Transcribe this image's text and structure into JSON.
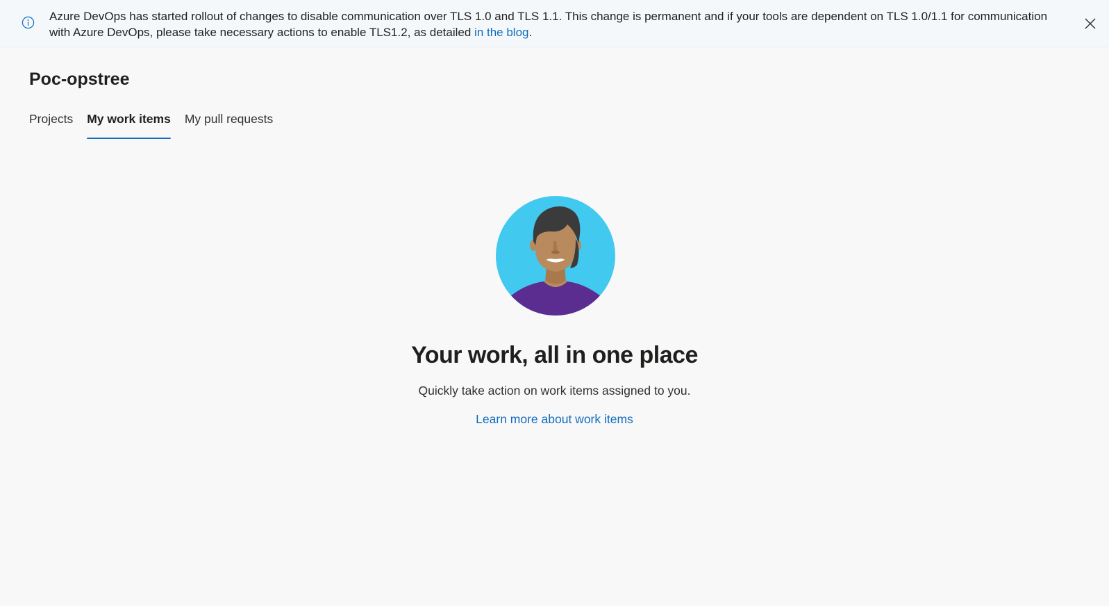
{
  "banner": {
    "icon": "info-icon",
    "message": "Azure DevOps has started rollout of changes to disable communication over TLS 1.0 and TLS 1.1. This change is permanent and if your tools are dependent on TLS 1.0/1.1 for communication with Azure DevOps, please take necessary actions to enable TLS1.2, as detailed ",
    "link_text": "in the blog",
    "trailing": ".",
    "close_icon": "close-icon"
  },
  "org": {
    "title": "Poc-opstree"
  },
  "tabs": [
    {
      "label": "Projects",
      "active": false
    },
    {
      "label": "My work items",
      "active": true
    },
    {
      "label": "My pull requests",
      "active": false
    }
  ],
  "empty_state": {
    "illustration": "person-avatar-illustration",
    "headline": "Your work, all in one place",
    "description": "Quickly take action on work items assigned to you.",
    "link_text": "Learn more about work items"
  },
  "colors": {
    "accent": "#0f6cbd",
    "avatar_background": "#41c9f0",
    "avatar_shirt": "#5c2d91",
    "avatar_skin": "#b98a5e",
    "avatar_hair": "#3b3b3b"
  }
}
